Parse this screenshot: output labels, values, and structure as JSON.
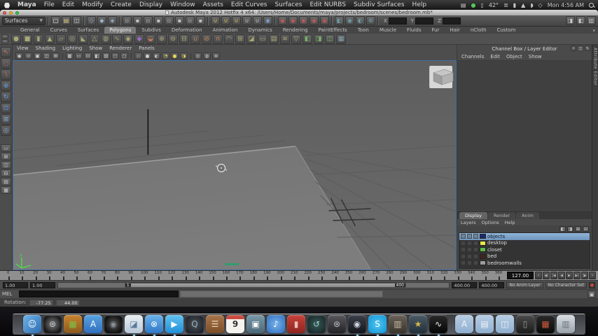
{
  "menubar": {
    "items": [
      "Maya",
      "File",
      "Edit",
      "Modify",
      "Create",
      "Display",
      "Window",
      "Assets",
      "Edit Curves",
      "Surfaces",
      "Edit NURBS",
      "Subdiv Surfaces",
      "Help"
    ],
    "extras": [
      {
        "name": "display-icon",
        "glyph": "▤",
        "color": "#c8c8c8"
      },
      {
        "name": "time-machine-menu-icon",
        "glyph": "●",
        "color": "#57c45a"
      },
      {
        "name": "keyboard-menu-icon",
        "glyph": "▯",
        "color": "#c8c8c8"
      },
      {
        "name": "temperature",
        "glyph": "42°",
        "color": "#d0d0d0"
      },
      {
        "name": "meter-icon",
        "glyph": "≣",
        "color": "#b8b8b8"
      },
      {
        "name": "battery-icon",
        "glyph": "▮",
        "color": "#c8c8c8"
      },
      {
        "name": "eject-icon",
        "glyph": "▲",
        "color": "#c8c8c8"
      },
      {
        "name": "volume-icon",
        "glyph": "◗",
        "color": "#c8c8c8"
      },
      {
        "name": "bluetooth-icon",
        "glyph": "◇",
        "color": "#c8c8c8"
      }
    ],
    "clock": "Mon 4:56 AM"
  },
  "window": {
    "title": "Autodesk Maya 2012 Hotfix 4 x64: /Users/Home/Documents/maya/projects/bedroom/scenes/bedroom.mb*"
  },
  "statusline": {
    "menuset": "Surfaces",
    "file_icons": [
      {
        "name": "new-scene-icon",
        "glyph": "▢",
        "color": "#e8e8e8"
      },
      {
        "name": "open-scene-icon",
        "glyph": "▤",
        "color": "#d8c878"
      },
      {
        "name": "save-scene-icon",
        "glyph": "◫",
        "color": "#c8c8c8"
      }
    ],
    "select_icons": [
      {
        "name": "select-hierarchy-icon",
        "glyph": "◇",
        "color": "#9ab4cc"
      },
      {
        "name": "select-object-icon",
        "glyph": "◆",
        "color": "#9ab4cc"
      },
      {
        "name": "select-component-icon",
        "glyph": "◈",
        "color": "#9ab4cc"
      }
    ],
    "mask_icons": [
      {
        "name": "mask-handles-icon",
        "glyph": "▫",
        "color": "#c0c0c0"
      },
      {
        "name": "mask-joints-icon",
        "glyph": "▪",
        "color": "#c0c0c0"
      },
      {
        "name": "mask-curves-icon",
        "glyph": "▫",
        "color": "#c0c0c0"
      },
      {
        "name": "mask-surfaces-icon",
        "glyph": "▪",
        "color": "#c0c0c0"
      },
      {
        "name": "mask-deformers-icon",
        "glyph": "▫",
        "color": "#c0c0c0"
      },
      {
        "name": "mask-dynamics-icon",
        "glyph": "▪",
        "color": "#c0c0c0"
      },
      {
        "name": "mask-rendering-icon",
        "glyph": "▫",
        "color": "#c0c0c0"
      },
      {
        "name": "mask-misc-icon",
        "glyph": "▪",
        "color": "#c0c0c0"
      }
    ],
    "snap_icons": [
      {
        "name": "snap-grid-icon",
        "glyph": "∪",
        "color": "#ddc84a"
      },
      {
        "name": "snap-curve-icon",
        "glyph": "∪",
        "color": "#ddc84a"
      },
      {
        "name": "snap-point-icon",
        "glyph": "∪",
        "color": "#ddc84a"
      },
      {
        "name": "snap-projected-center-icon",
        "glyph": "∪",
        "color": "#c8c8c8"
      },
      {
        "name": "snap-view-plane-icon",
        "glyph": "∪",
        "color": "#c8c8c8"
      },
      {
        "name": "make-live-icon",
        "glyph": "◉",
        "color": "#7aa0d0"
      }
    ],
    "history_icons": [
      {
        "name": "input-connections-icon",
        "glyph": "◉",
        "color": "#c05a5a"
      },
      {
        "name": "output-connections-icon",
        "glyph": "◉",
        "color": "#c05a5a"
      },
      {
        "name": "construction-history-icon",
        "glyph": "◉",
        "color": "#c05a5a"
      },
      {
        "name": "highlight-selection-icon",
        "glyph": "◉",
        "color": "#c05a5a"
      },
      {
        "name": "selection-extra-icon",
        "glyph": "◉",
        "color": "#c05a5a"
      }
    ],
    "render_icons": [
      {
        "name": "render-view-icon",
        "glyph": "◧",
        "color": "#6aa0a8"
      },
      {
        "name": "render-current-frame-icon",
        "glyph": "◉",
        "color": "#6aa0a8"
      },
      {
        "name": "ipr-render-icon",
        "glyph": "◐",
        "color": "#6aa0a8"
      },
      {
        "name": "render-settings-icon",
        "glyph": "⊛",
        "color": "#6aa0a8"
      }
    ],
    "coord_fields": [
      {
        "label": "X",
        "value": ""
      },
      {
        "label": "Y",
        "value": ""
      },
      {
        "label": "Z",
        "value": ""
      }
    ],
    "right_icons": [
      {
        "name": "toggle-attribute-editor-icon",
        "glyph": "◨",
        "color": "#c8c8c8"
      },
      {
        "name": "toggle-tool-settings-icon",
        "glyph": "◧",
        "color": "#c8c8c8"
      },
      {
        "name": "toggle-channel-box-icon",
        "glyph": "▥",
        "color": "#c8c8c8"
      }
    ]
  },
  "shelf": {
    "tabs": [
      {
        "label": "General"
      },
      {
        "label": "Curves"
      },
      {
        "label": "Surfaces"
      },
      {
        "label": "Polygons",
        "selected": true
      },
      {
        "label": "Subdivs"
      },
      {
        "label": "Deformation"
      },
      {
        "label": "Animation"
      },
      {
        "label": "Dynamics"
      },
      {
        "label": "Rendering"
      },
      {
        "label": "PaintEffects"
      },
      {
        "label": "Toon"
      },
      {
        "label": "Muscle"
      },
      {
        "label": "Fluids"
      },
      {
        "label": "Fur"
      },
      {
        "label": "Hair"
      },
      {
        "label": "nCloth"
      },
      {
        "label": "Custom"
      }
    ],
    "menu_arrow": "▾",
    "icons": [
      {
        "name": "poly-sphere-icon",
        "glyph": "●",
        "color": "#a8a878"
      },
      {
        "name": "poly-cube-icon",
        "glyph": "■",
        "color": "#a8a878"
      },
      {
        "name": "poly-cylinder-icon",
        "glyph": "▮",
        "color": "#a8a878"
      },
      {
        "name": "poly-cone-icon",
        "glyph": "▲",
        "color": "#a8a878"
      },
      {
        "name": "poly-plane-icon",
        "glyph": "▱",
        "color": "#a8a878"
      },
      {
        "name": "poly-torus-icon",
        "glyph": "◎",
        "color": "#a8a878"
      },
      {
        "name": "poly-prism-icon",
        "glyph": "◣",
        "color": "#a8a878"
      },
      {
        "name": "poly-pyramid-icon",
        "glyph": "△",
        "color": "#a8a878"
      },
      {
        "name": "poly-pipe-icon",
        "glyph": "◍",
        "color": "#a8a878"
      },
      {
        "name": "poly-helix-icon",
        "glyph": "∿",
        "color": "#a8a878"
      },
      {
        "name": "poly-soccer-ball-icon",
        "glyph": "◉",
        "color": "#a8a878"
      },
      {
        "name": "platonic-solid-icon",
        "glyph": "◆",
        "color": "#9a6ac0"
      },
      {
        "name": "sculpt-geometry-icon",
        "glyph": "◒",
        "color": "#c07a5a"
      },
      {
        "name": "combine-icon",
        "glyph": "⊕",
        "color": "#a8a878"
      },
      {
        "name": "separate-icon",
        "glyph": "⊖",
        "color": "#a8a878"
      },
      {
        "name": "extract-icon",
        "glyph": "⊟",
        "color": "#a8a878"
      },
      {
        "name": "boolean-union-icon",
        "glyph": "∪",
        "color": "#c08a5a"
      },
      {
        "name": "boolean-difference-icon",
        "glyph": "⊘",
        "color": "#c08a5a"
      },
      {
        "name": "boolean-intersection-icon",
        "glyph": "∩",
        "color": "#c08a5a"
      },
      {
        "name": "smooth-icon",
        "glyph": "◠",
        "color": "#a8a878"
      },
      {
        "name": "subdivide-icon",
        "glyph": "⊞",
        "color": "#a8a878"
      },
      {
        "name": "bevel-icon",
        "glyph": "◪",
        "color": "#a8a878"
      },
      {
        "name": "bridge-icon",
        "glyph": "▭",
        "color": "#a8a878"
      },
      {
        "name": "extrude-icon",
        "glyph": "▤",
        "color": "#a8a878"
      },
      {
        "name": "crease-icon",
        "glyph": "≋",
        "color": "#a8a878"
      },
      {
        "name": "reduce-icon",
        "glyph": "▽",
        "color": "#a8a878"
      },
      {
        "name": "mirror-x-icon",
        "glyph": "◧",
        "color": "#7ab06a"
      },
      {
        "name": "mirror-y-icon",
        "glyph": "◨",
        "color": "#7ab06a"
      },
      {
        "name": "mirror-z-icon",
        "glyph": "◫",
        "color": "#7ab06a"
      },
      {
        "name": "quad-draw-icon",
        "glyph": "▦",
        "color": "#88a0b0"
      }
    ]
  },
  "toolbox": {
    "tools": [
      {
        "name": "select-tool",
        "glyph": "↖",
        "color": "#e06a5a"
      },
      {
        "name": "lasso-tool",
        "glyph": "◌",
        "color": "#e06a5a"
      },
      {
        "name": "paint-select-tool",
        "glyph": "∖",
        "color": "#e06a5a"
      },
      {
        "name": "move-tool",
        "glyph": "⊕",
        "color": "#6a9ae0"
      },
      {
        "name": "rotate-tool",
        "glyph": "↻",
        "color": "#6a9ae0"
      },
      {
        "name": "scale-tool",
        "glyph": "⊡",
        "color": "#6a9ae0"
      },
      {
        "name": "universal-manipulator-tool",
        "glyph": "⊞",
        "color": "#8ab0d8"
      },
      {
        "name": "soft-modification-tool",
        "glyph": "◎",
        "color": "#8ab0d8"
      }
    ],
    "layouts": [
      {
        "name": "layout-single-pane",
        "glyph": "▭"
      },
      {
        "name": "layout-four-pane",
        "glyph": "⊞"
      },
      {
        "name": "layout-persp-outliner",
        "glyph": "◫"
      },
      {
        "name": "layout-split-horizontal",
        "glyph": "⊟"
      },
      {
        "name": "layout-hypershade",
        "glyph": "▤"
      },
      {
        "name": "layout-custom",
        "glyph": "▦"
      }
    ]
  },
  "panel": {
    "menus": [
      "View",
      "Shading",
      "Lighting",
      "Show",
      "Renderer",
      "Panels"
    ],
    "icons_a": [
      {
        "name": "select-camera-icon",
        "glyph": "◉",
        "color": "#d0d0d0"
      },
      {
        "name": "camera-attributes-icon",
        "glyph": "⊙",
        "color": "#d0d0d0"
      },
      {
        "name": "bookmark-icon",
        "glyph": "▣",
        "color": "#d0d0d0"
      },
      {
        "name": "image-plane-icon",
        "glyph": "◫",
        "color": "#d0d0d0"
      },
      {
        "name": "pan-zoom-2d-icon",
        "glyph": "⊞",
        "color": "#d0d0d0"
      }
    ],
    "icons_b": [
      {
        "name": "grid-icon",
        "glyph": "▦",
        "color": "#d0d0d0"
      },
      {
        "name": "film-gate-icon",
        "glyph": "▭",
        "color": "#d0d0d0"
      },
      {
        "name": "resolution-gate-icon",
        "glyph": "⊡",
        "color": "#d0d0d0"
      },
      {
        "name": "gate-mask-icon",
        "glyph": "◧",
        "color": "#d0d0d0"
      },
      {
        "name": "field-chart-icon",
        "glyph": "▤",
        "color": "#d0d0d0"
      },
      {
        "name": "safe-action-icon",
        "glyph": "◻",
        "color": "#d0d0d0"
      },
      {
        "name": "safe-title-icon",
        "glyph": "▢",
        "color": "#d0d0d0"
      }
    ],
    "icons_c": [
      {
        "name": "wireframe-icon",
        "glyph": "◇",
        "color": "#d0d0d0"
      },
      {
        "name": "smooth-shade-icon",
        "glyph": "●",
        "color": "#d0d0d0"
      },
      {
        "name": "textured-icon",
        "glyph": "◐",
        "color": "#d0d0d0"
      },
      {
        "name": "default-lighting-icon",
        "glyph": "◔",
        "color": "#e8d855"
      },
      {
        "name": "all-lights-icon",
        "glyph": "●",
        "color": "#e8d855"
      },
      {
        "name": "two-sided-lighting-icon",
        "glyph": "◑",
        "color": "#e8d855"
      }
    ],
    "icons_d": [
      {
        "name": "isolate-select-icon",
        "glyph": "◎",
        "color": "#d0d0d0"
      },
      {
        "name": "xray-icon",
        "glyph": "◍",
        "color": "#d0d0d0"
      },
      {
        "name": "plugin-shading-icon",
        "glyph": "⊗",
        "color": "#d0d0d0"
      }
    ]
  },
  "channelbox": {
    "title": "Channel Box / Layer Editor",
    "corner_icons": [
      {
        "name": "pin-icon",
        "glyph": "•"
      },
      {
        "name": "manipulator-link-icon",
        "glyph": "◫"
      },
      {
        "name": "speed-edit-icon",
        "glyph": "✎"
      }
    ],
    "menus": [
      "Channels",
      "Edit",
      "Object",
      "Show"
    ],
    "side_tab": "Attribute Editor"
  },
  "layer_editor": {
    "tabs": [
      {
        "label": "Display",
        "selected": true
      },
      {
        "label": "Render"
      },
      {
        "label": "Anim"
      }
    ],
    "menus": [
      "Layers",
      "Options",
      "Help"
    ],
    "icons": [
      {
        "name": "layer-move-up-icon",
        "glyph": "◧"
      },
      {
        "name": "layer-move-down-icon",
        "glyph": "◨"
      },
      {
        "name": "new-empty-layer-icon",
        "glyph": "⊞"
      },
      {
        "name": "new-layer-from-selected-icon",
        "glyph": "⊟"
      }
    ],
    "layers": [
      {
        "name": "objects",
        "color": "#1c2a72",
        "selected": true
      },
      {
        "name": "desktop",
        "color": "#e8e84e"
      },
      {
        "name": "closet",
        "color": "#5cb944"
      },
      {
        "name": "bed",
        "color": "#402424"
      },
      {
        "name": "bedroomwalls",
        "color": "#9c9c9c"
      }
    ]
  },
  "timeline": {
    "ticks": [
      0,
      10,
      20,
      30,
      40,
      50,
      60,
      70,
      80,
      90,
      100,
      110,
      120,
      130,
      140,
      150,
      160,
      170,
      180,
      190,
      200,
      210,
      220,
      230,
      240,
      250,
      260,
      270,
      280,
      290,
      300,
      310,
      320,
      330,
      340,
      350,
      360
    ],
    "current": "127.00",
    "playback": [
      {
        "name": "goto-start-button",
        "glyph": "«"
      },
      {
        "name": "step-back-frame-button",
        "glyph": "◀|"
      },
      {
        "name": "step-back-key-button",
        "glyph": "|◀"
      },
      {
        "name": "play-backward-button",
        "glyph": "◀"
      },
      {
        "name": "play-forward-button",
        "glyph": "▶"
      },
      {
        "name": "step-forward-key-button",
        "glyph": "▶|"
      },
      {
        "name": "step-forward-frame-button",
        "glyph": "|▶"
      },
      {
        "name": "goto-end-button",
        "glyph": "»"
      }
    ]
  },
  "rangeslider": {
    "anim_start": "1.00",
    "playback_start": "1.00",
    "handle_start": "1",
    "handle_end": "400",
    "playback_end": "400.00",
    "anim_end": "400.00",
    "anim_layer": "No Anim Layer",
    "character_set": "No Character Set"
  },
  "commandline": {
    "label": "MEL"
  },
  "helpline": {
    "label": "Rotation:",
    "v1": "-77.25",
    "v2": "44.00"
  },
  "dock": {
    "apps": [
      {
        "name": "finder",
        "glyph": "☺",
        "bg": "linear-gradient(135deg,#6db3e8,#2f6cb0)",
        "fg": "#ffffff",
        "running": true
      },
      {
        "name": "launchpad",
        "glyph": "⊛",
        "bg": "radial-gradient(circle,#555 30%,#1a1a1a 70%)",
        "fg": "#cfd4dc"
      },
      {
        "name": "utility-app",
        "glyph": "▦",
        "bg": "linear-gradient(#c9832f,#8a5a1e)",
        "fg": "#7ac44a"
      },
      {
        "name": "app-store",
        "glyph": "A",
        "bg": "linear-gradient(#5aa2e0,#2f6fc0)",
        "fg": "#ffffff"
      },
      {
        "name": "dashboard",
        "glyph": "◉",
        "bg": "radial-gradient(circle,#3a3a3a 30%,#111 70%)",
        "fg": "#8a9098"
      },
      {
        "name": "preview",
        "glyph": "◪",
        "bg": "linear-gradient(#e8eef4,#b8c8d8)",
        "fg": "#5a7a9a",
        "running": true
      },
      {
        "name": "safari",
        "glyph": "⊗",
        "bg": "linear-gradient(#6ab2ec,#2f78c8)",
        "fg": "#ffffff",
        "running": true
      },
      {
        "name": "facetime",
        "glyph": "▶",
        "bg": "linear-gradient(#62c2f0,#1f8fd8)",
        "fg": "#ffffff",
        "running": true
      },
      {
        "name": "quicktime",
        "glyph": "Q",
        "bg": "radial-gradient(circle,#4a5058,#17191f)",
        "fg": "#9ab0c0"
      },
      {
        "name": "address-book",
        "glyph": "☰",
        "bg": "linear-gradient(#a9744a,#7a4e28)",
        "fg": "#e8d8b8"
      },
      {
        "name": "ical",
        "label": "9",
        "bg": "linear-gradient(#c94a3f 0 24%,#f4f3ee 24%)",
        "fg": "#333333"
      },
      {
        "name": "photo-booth",
        "glyph": "▣",
        "bg": "linear-gradient(#7a98a8,#4a6878)",
        "fg": "#ffffff"
      },
      {
        "name": "itunes",
        "glyph": "♪",
        "bg": "radial-gradient(circle,#79b3ea,#2b6cc0)",
        "fg": "#ffffff"
      },
      {
        "name": "dvd-player",
        "glyph": "▮",
        "bg": "linear-gradient(#c7423a,#8e241e)",
        "fg": "#e8c0b8"
      },
      {
        "name": "time-machine",
        "glyph": "↺",
        "bg": "radial-gradient(circle,#3a5a58,#101f1f)",
        "fg": "#9ad0c8"
      },
      {
        "name": "system-preferences",
        "glyph": "⊛",
        "bg": "linear-gradient(#57575c,#232328)",
        "fg": "#c0c0c4"
      },
      {
        "name": "steam",
        "glyph": "◉",
        "bg": "linear-gradient(#3a3f4a,#14161c)",
        "fg": "#cfd4dc",
        "running": true
      },
      {
        "name": "skype",
        "glyph": "S",
        "bg": "radial-gradient(circle,#53c5f2,#0d93d6)",
        "fg": "#ffffff",
        "running": true
      },
      {
        "name": "game-app",
        "glyph": "▥",
        "bg": "linear-gradient(#6a6258,#3a342c)",
        "fg": "#cbbfa8",
        "running": true
      },
      {
        "name": "imovie",
        "glyph": "★",
        "bg": "linear-gradient(#4a5a66,#22303a)",
        "fg": "#d8b84a",
        "running": true
      },
      {
        "name": "maya",
        "glyph": "∿",
        "bg": "linear-gradient(#2a2a2a,#050505)",
        "fg": "#f0f0f0",
        "running": true
      }
    ],
    "places": [
      {
        "name": "folder-applications",
        "glyph": "A",
        "bg": "linear-gradient(#b8cde4,#8fafd0)",
        "fg": "rgba(255,255,255,.85)"
      },
      {
        "name": "folder-documents",
        "glyph": "▤",
        "bg": "linear-gradient(#b8cde4,#8fafd0)",
        "fg": "rgba(255,255,255,.85)"
      },
      {
        "name": "folder-downloads",
        "glyph": "◫",
        "bg": "linear-gradient(#b8cde4,#8fafd0)",
        "fg": "rgba(255,255,255,.85)"
      },
      {
        "name": "external-drive",
        "glyph": "▯",
        "bg": "linear-gradient(#4a4a4a,#1c1c1c)",
        "fg": "#9a9a9a"
      },
      {
        "name": "grid-utility",
        "glyph": "▦",
        "bg": "linear-gradient(#2a2a2a,#0a0a0a)",
        "fg": "#d05a3a"
      },
      {
        "name": "trash",
        "glyph": "▥",
        "bg": "linear-gradient(#d8dde2,#9aa2aa)",
        "fg": "#6a727a"
      }
    ]
  }
}
